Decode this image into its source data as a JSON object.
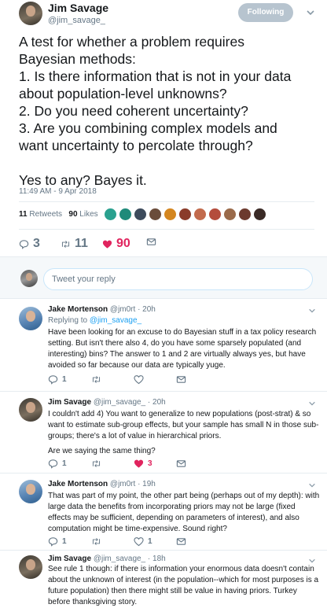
{
  "tweet": {
    "author_name": "Jim Savage",
    "author_handle": "@jim_savage_",
    "follow_label": "Following",
    "lines": [
      "A test for whether a problem requires",
      "Bayesian methods:",
      "1. Is there information that is not in your data",
      "about population-level unknowns?",
      "2. Do you need coherent uncertainty?",
      "3. Are you combining complex models and",
      "want uncertainty to percolate through?"
    ],
    "closing": "Yes to any? Bayes it.",
    "timestamp": "11:49 AM - 9 Apr 2018",
    "retweets_count": "11",
    "retweets_label": "Retweets",
    "likes_count": "90",
    "likes_label": "Likes",
    "reply_count": "3",
    "retweet_count": "11",
    "like_count": "90",
    "liker_colors": [
      "#2aa18f",
      "#1f8a7a",
      "#3d4b5c",
      "#6a4c3a",
      "#d4861f",
      "#8a3b2a",
      "#c26a4c",
      "#b44c3c",
      "#9a6a4a",
      "#6c3a2e",
      "#3a2a26"
    ]
  },
  "reply_box": {
    "placeholder": "Tweet your reply"
  },
  "replies": [
    {
      "name": "Jake Mortenson",
      "handle": "@jm0rt",
      "time": "· 20h",
      "replying_prefix": "Replying to",
      "replying_to": "@jim_savage_",
      "text": "Have been looking for an excuse to do Bayesian stuff in a tax policy research setting. But isn't there also 4, do you have some sparsely populated (and interesting) bins? The answer to 1 and 2 are virtually always yes, but have avoided so far because our data are typically yuge.",
      "reply_count": "1",
      "retweet_count": "",
      "like_count": ""
    },
    {
      "name": "Jim Savage",
      "handle": "@jim_savage_",
      "time": "· 20h",
      "text": "I couldn't add 4) You want to generalize to new populations (post-strat) & so want to estimate sub-group effects, but your sample has small N in those sub-groups; there's a lot of value in hierarchical priors.",
      "text2": "Are we saying the same thing?",
      "reply_count": "1",
      "retweet_count": "",
      "like_count": "3"
    },
    {
      "name": "Jake Mortenson",
      "handle": "@jm0rt",
      "time": "· 19h",
      "text": "That was part of my point, the other part being (perhaps out of my depth): with large data the benefits from incorporating priors may not be large (fixed effects may be sufficient, depending on parameters of interest), and also computation might be time-expensive. Sound right?",
      "reply_count": "1",
      "retweet_count": "",
      "like_count": "1"
    },
    {
      "name": "Jim Savage",
      "handle": "@jim_savage_",
      "time": "· 18h",
      "text": "See rule 1 though: if there is information your enormous data doesn't contain about the unknown of interest (in the population--which for most purposes is a future population) then there might still be value in having priors. Turkey before thanksgiving story."
    }
  ],
  "colors": {
    "accent": "#1da1f2",
    "like": "#e0245e",
    "muted": "#657786"
  }
}
